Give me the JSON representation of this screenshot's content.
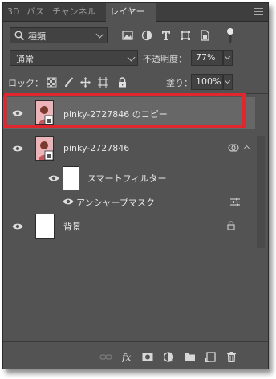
{
  "tabs": [
    {
      "label": "3D",
      "active": false
    },
    {
      "label": "パス",
      "active": false
    },
    {
      "label": "チャンネル",
      "active": false
    },
    {
      "label": "レイヤー",
      "active": true
    }
  ],
  "filter": {
    "label": "種類"
  },
  "blend_mode": {
    "value": "通常"
  },
  "opacity": {
    "label": "不透明度：",
    "value": "77%"
  },
  "lock": {
    "label": "ロック："
  },
  "fill": {
    "label": "塗り：",
    "value": "100%"
  },
  "layers": [
    {
      "name": "pinky-2727846 のコピー",
      "selected": true
    },
    {
      "name": "pinky-2727846",
      "selected": false
    },
    {
      "name": "スマートフィルター"
    },
    {
      "name": "アンシャープマスク"
    },
    {
      "name": "背景"
    }
  ],
  "colors": {
    "highlight": "#e0262e",
    "panel": "#535353",
    "selected_row": "#676767"
  },
  "icons": [
    "search-icon",
    "image-filter-icon",
    "adjustment-filter-icon",
    "type-filter-icon",
    "shape-filter-icon",
    "smart-object-filter-icon",
    "lock-pixels-icon",
    "lock-paint-icon",
    "lock-position-icon",
    "lock-artboard-icon",
    "lock-all-icon",
    "link-icon",
    "fx-icon",
    "mask-icon",
    "adjustment-icon",
    "folder-icon",
    "new-layer-icon",
    "trash-icon"
  ]
}
